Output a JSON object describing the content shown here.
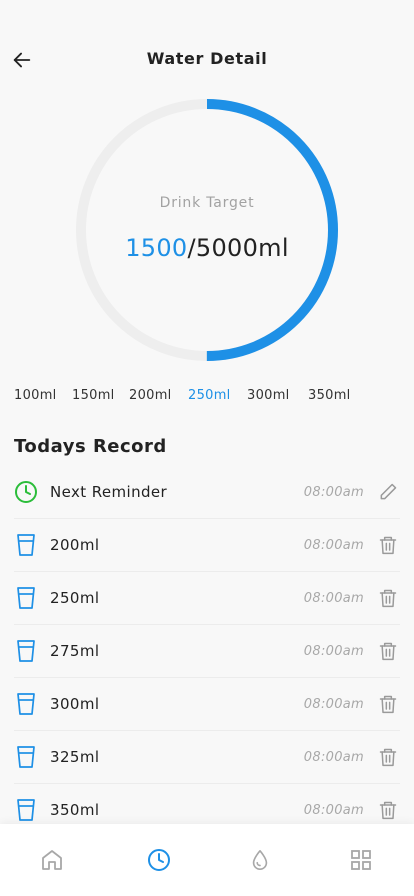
{
  "header": {
    "title": "Water Detail"
  },
  "ring": {
    "label": "Drink Target",
    "current": "1500",
    "target": "/5000ml",
    "progress": 0.5
  },
  "amounts": [
    {
      "label": "100ml",
      "active": false
    },
    {
      "label": "150ml",
      "active": false
    },
    {
      "label": "200ml",
      "active": false
    },
    {
      "label": "250ml",
      "active": true
    },
    {
      "label": "300ml",
      "active": false
    },
    {
      "label": "350ml",
      "active": false
    }
  ],
  "records": {
    "title": "Todays Record",
    "reminder": {
      "label": "Next Reminder",
      "time": "08:00am",
      "icon": "clock-icon",
      "action_icon": "edit-icon"
    },
    "items": [
      {
        "label": "200ml",
        "time": "08:00am"
      },
      {
        "label": "250ml",
        "time": "08:00am"
      },
      {
        "label": "275ml",
        "time": "08:00am"
      },
      {
        "label": "300ml",
        "time": "08:00am"
      },
      {
        "label": "325ml",
        "time": "08:00am"
      },
      {
        "label": "350ml",
        "time": "08:00am"
      }
    ]
  },
  "nav": [
    {
      "icon": "home-icon",
      "active": false
    },
    {
      "icon": "clock-icon",
      "active": true
    },
    {
      "icon": "water-drop-icon",
      "active": false
    },
    {
      "icon": "grid-icon",
      "active": false
    }
  ],
  "colors": {
    "accent": "#1e90e6",
    "reminder_green": "#2bbd3a",
    "ring_track": "#eeeeee",
    "muted": "#a8a8a8"
  }
}
